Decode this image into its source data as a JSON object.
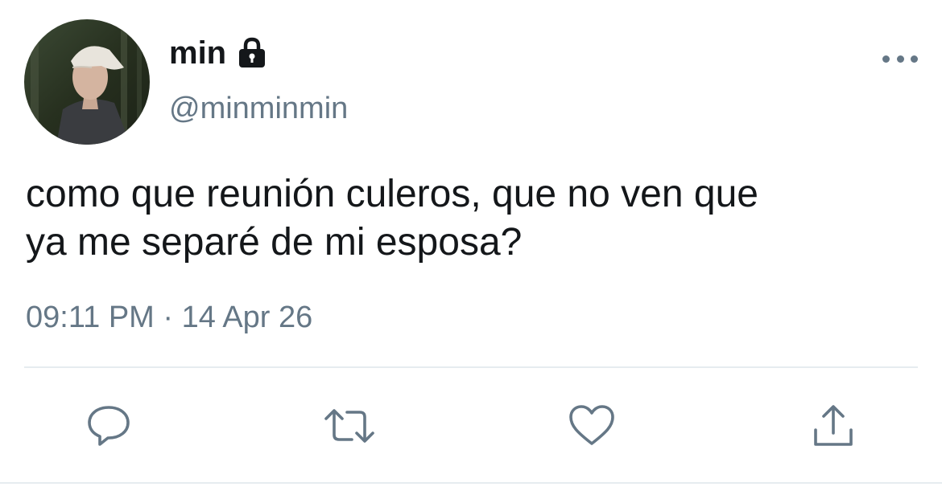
{
  "tweet": {
    "display_name": "min",
    "handle": "@minminmin",
    "text": "como que reunión culeros, que no ven que\nya me separé de mi esposa?",
    "timestamp": "09:11 PM · 14 Apr 26",
    "protected": true
  },
  "icons": {
    "avatar": "profile-photo",
    "lock": "lock-icon",
    "more": "more-options-icon",
    "reply": "reply-icon",
    "retweet": "retweet-icon",
    "like": "like-icon",
    "share": "share-icon"
  },
  "colors": {
    "text_primary": "#14171a",
    "text_secondary": "#657786",
    "divider": "#e6ecf0"
  }
}
